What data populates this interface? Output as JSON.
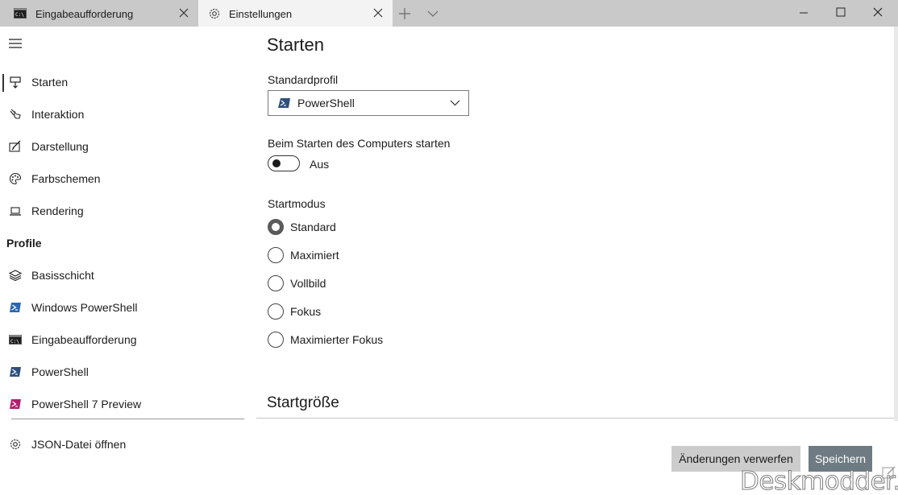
{
  "window": {
    "tabs": [
      {
        "title": "Eingabeaufforderung",
        "icon": "cmd-icon"
      },
      {
        "title": "Einstellungen",
        "icon": "gear-icon",
        "active": true
      }
    ]
  },
  "sidebar": {
    "items": [
      {
        "label": "Starten",
        "icon": "launch-icon"
      },
      {
        "label": "Interaktion",
        "icon": "interaction-icon"
      },
      {
        "label": "Darstellung",
        "icon": "appearance-icon"
      },
      {
        "label": "Farbschemen",
        "icon": "palette-icon"
      },
      {
        "label": "Rendering",
        "icon": "laptop-icon"
      }
    ],
    "profiles_header": "Profile",
    "profiles": [
      {
        "label": "Basisschicht",
        "icon": "layers-icon"
      },
      {
        "label": "Windows PowerShell",
        "icon": "powershell-icon"
      },
      {
        "label": "Eingabeaufforderung",
        "icon": "cmd-icon"
      },
      {
        "label": "PowerShell",
        "icon": "powershell-icon"
      },
      {
        "label": "PowerShell 7 Preview",
        "icon": "powershell-preview-icon"
      }
    ],
    "json_link": {
      "label": "JSON-Datei öffnen",
      "icon": "gear-icon"
    }
  },
  "main": {
    "title": "Starten",
    "default_profile": {
      "label": "Standardprofil",
      "value": "PowerShell"
    },
    "startup": {
      "label": "Beim Starten des Computers starten",
      "state": "Aus"
    },
    "launch_mode": {
      "label": "Startmodus",
      "options": [
        "Standard",
        "Maximiert",
        "Vollbild",
        "Fokus",
        "Maximierter Fokus"
      ],
      "selected": "Standard"
    },
    "next_section": "Startgröße"
  },
  "buttons": {
    "discard": "Änderungen verwerfen",
    "save": "Speichern"
  },
  "watermark": "Deskmodder.de",
  "colors": {
    "tabbar": "#c9c9c9",
    "active_tab": "#f3f3f3",
    "save_button": "#6f7b83",
    "discard_button": "#cccccc"
  }
}
